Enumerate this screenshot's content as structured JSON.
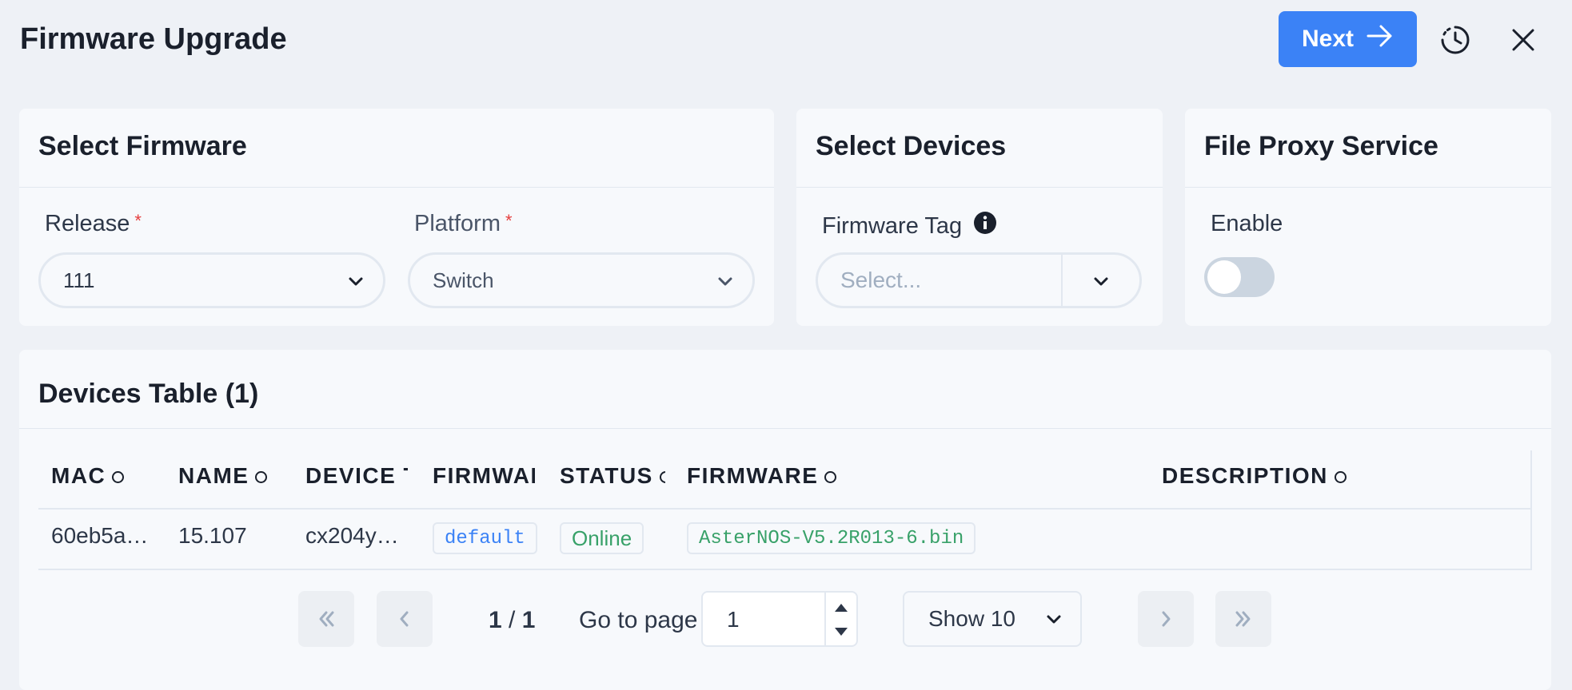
{
  "header": {
    "title": "Firmware Upgrade",
    "next_label": "Next"
  },
  "select_firmware": {
    "title": "Select Firmware",
    "release_label": "Release",
    "release_value": "111",
    "platform_label": "Platform",
    "platform_value": "Switch",
    "required_mark": "*"
  },
  "select_devices": {
    "title": "Select Devices",
    "firmware_tag_label": "Firmware Tag",
    "firmware_tag_placeholder": "Select..."
  },
  "file_proxy": {
    "title": "File Proxy Service",
    "enable_label": "Enable",
    "enabled": false
  },
  "devices_table": {
    "title": "Devices Table (1)",
    "columns": [
      "MAC",
      "NAME",
      "DEVICE T",
      "FIRMWAI",
      "STATUS",
      "FIRMWARE",
      "DESCRIPTION"
    ],
    "rows": [
      {
        "mac": "60eb5a…",
        "name": "15.107",
        "device_type": "cx204y…",
        "firmware_tag": "default",
        "status": "Online",
        "firmware": "AsterNOS-V5.2R013-6.bin",
        "description": ""
      }
    ]
  },
  "pagination": {
    "current_page": "1",
    "total_pages": "1",
    "separator": "/",
    "goto_label": "Go to page",
    "goto_value": "1",
    "page_size_label": "Show 10"
  },
  "colors": {
    "primary": "#3b82f6",
    "tag_blue": "#3b82f6",
    "status_green": "#38a169",
    "background": "#eef1f6"
  }
}
